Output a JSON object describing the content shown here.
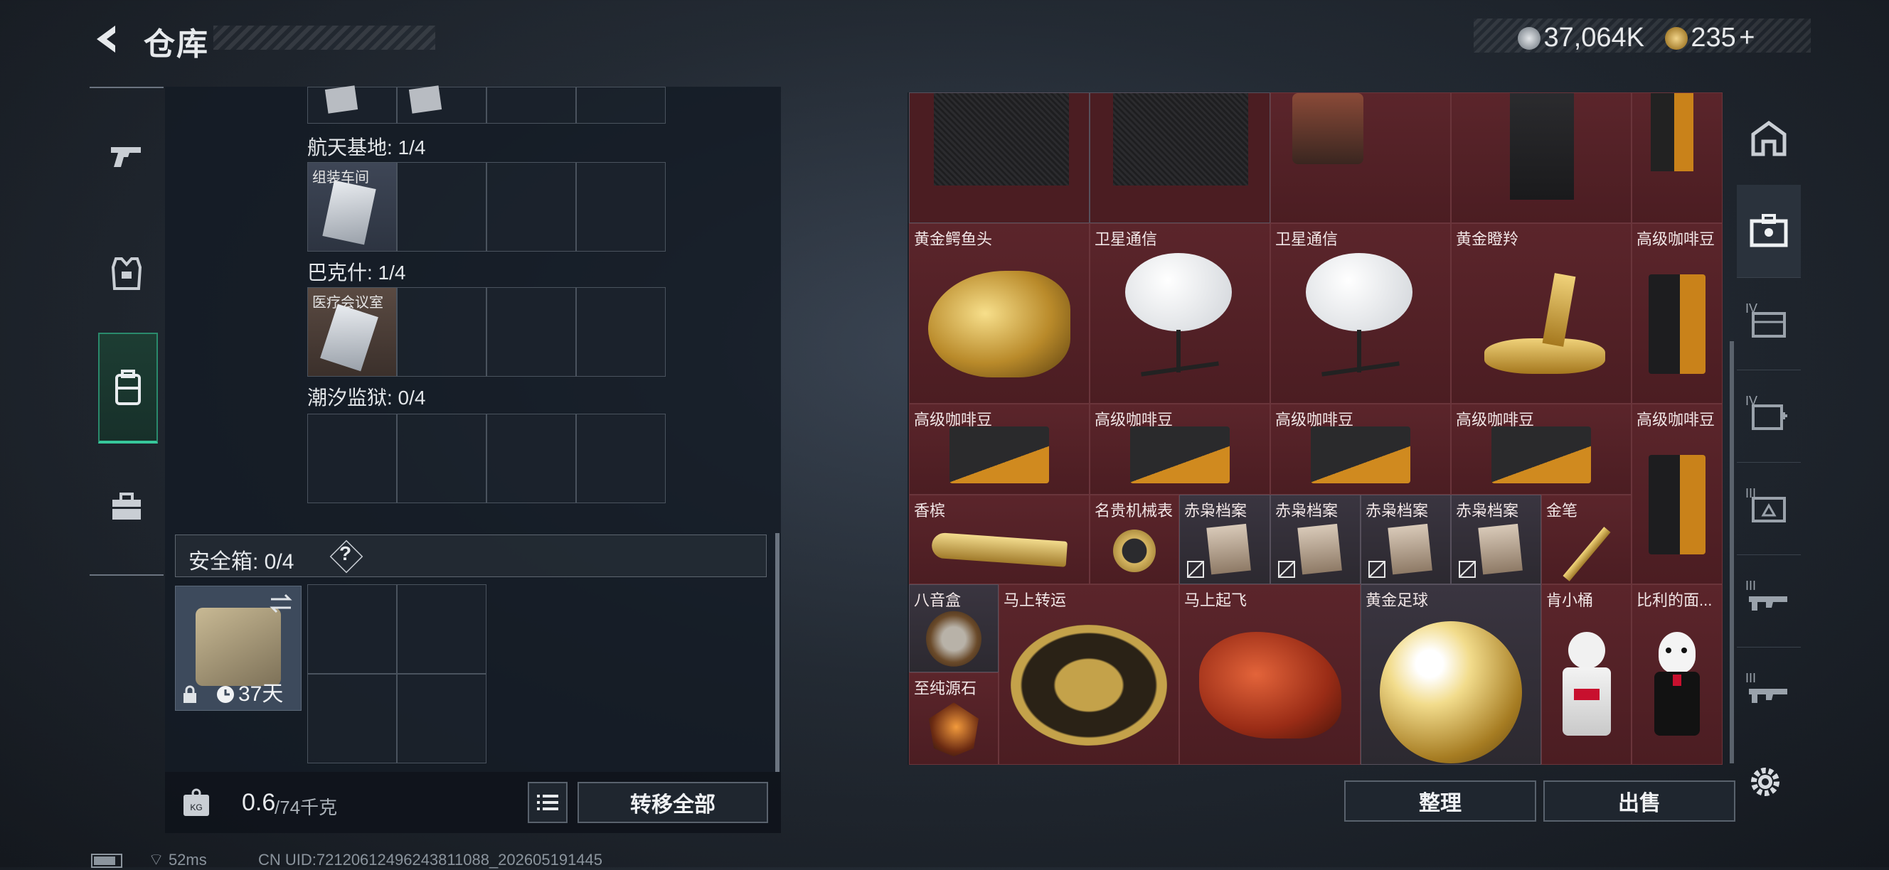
{
  "header": {
    "title": "仓库",
    "silver_amount": "37,064K",
    "gold_amount": "235",
    "plus": "+"
  },
  "left_nav": [
    {
      "name": "weapons",
      "icon": "pistol-icon"
    },
    {
      "name": "armor",
      "icon": "vest-icon"
    },
    {
      "name": "backpack",
      "icon": "backpack-icon",
      "active": true
    },
    {
      "name": "case",
      "icon": "briefcase-icon"
    }
  ],
  "keycards": {
    "sections": [
      {
        "label": "航天基地: 1/4",
        "card": "组装车间"
      },
      {
        "label": "巴克什: 1/4",
        "card": "医疗会议室"
      },
      {
        "label": "潮汐监狱: 0/4",
        "card": ""
      }
    ]
  },
  "safe": {
    "label": "安全箱: 0/4",
    "help": "?",
    "days": "37天"
  },
  "bottom_left": {
    "weight_value": "0.6",
    "weight_total": "/74千克",
    "transfer_all": "转移全部"
  },
  "stash": {
    "items": [
      {
        "name": "黄金鳄鱼头",
        "art": "gold-croc"
      },
      {
        "name": "卫星通信",
        "art": "dish"
      },
      {
        "name": "卫星通信",
        "art": "dish"
      },
      {
        "name": "黄金瞪羚",
        "art": "gold-deer"
      },
      {
        "name": "高级咖啡豆",
        "art": "coffee-bag"
      },
      {
        "name": "高级咖啡豆",
        "art": "coffee-box"
      },
      {
        "name": "高级咖啡豆",
        "art": "coffee-box"
      },
      {
        "name": "高级咖啡豆",
        "art": "coffee-box"
      },
      {
        "name": "高级咖啡豆",
        "art": "coffee-box"
      },
      {
        "name": "高级咖啡豆",
        "art": "coffee-bag"
      },
      {
        "name": "香槟",
        "art": "champagne"
      },
      {
        "name": "名贵机械表",
        "art": "watch"
      },
      {
        "name": "赤枭档案",
        "art": "file"
      },
      {
        "name": "赤枭档案",
        "art": "file"
      },
      {
        "name": "赤枭档案",
        "art": "file"
      },
      {
        "name": "赤枭档案",
        "art": "file"
      },
      {
        "name": "金笔",
        "art": "pen"
      },
      {
        "name": "八音盒",
        "art": "music-box"
      },
      {
        "name": "至纯源石",
        "art": "gem"
      },
      {
        "name": "马上转运",
        "art": "horse-wheel"
      },
      {
        "name": "马上起飞",
        "art": "red-horse"
      },
      {
        "name": "黄金足球",
        "art": "gold-ball"
      },
      {
        "name": "肯小桶",
        "art": "kfc-figure"
      },
      {
        "name": "比利的面...",
        "art": "billy-figure"
      }
    ]
  },
  "bottom_right": {
    "sort": "整理",
    "sell": "出售"
  },
  "right_sidebar": [
    {
      "icon": "home-icon",
      "tier": ""
    },
    {
      "icon": "case-icon",
      "tier": ""
    },
    {
      "icon": "container-icon",
      "tier": "IV"
    },
    {
      "icon": "medkit-icon",
      "tier": "IV"
    },
    {
      "icon": "armor-box-icon",
      "tier": "III"
    },
    {
      "icon": "rifle-icon",
      "tier": "III"
    },
    {
      "icon": "rifle-icon",
      "tier": "III"
    }
  ],
  "status_bar": {
    "ping": "52ms",
    "uid": "CN UID:7212061249624381​1088_202605191445"
  }
}
